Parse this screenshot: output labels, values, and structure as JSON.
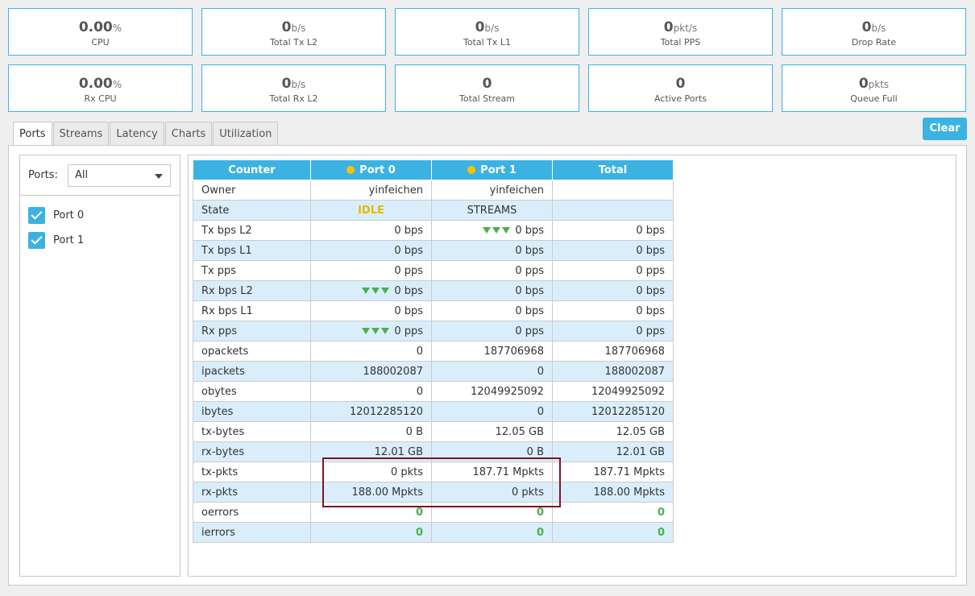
{
  "stats_row1": [
    {
      "value": "0.00",
      "unit": "%",
      "label": "CPU"
    },
    {
      "value": "0",
      "unit": "b/s",
      "label": "Total Tx L2"
    },
    {
      "value": "0",
      "unit": "b/s",
      "label": "Total Tx L1"
    },
    {
      "value": "0",
      "unit": "pkt/s",
      "label": "Total PPS"
    },
    {
      "value": "0",
      "unit": "b/s",
      "label": "Drop Rate"
    }
  ],
  "stats_row2": [
    {
      "value": "0.00",
      "unit": "%",
      "label": "Rx CPU"
    },
    {
      "value": "0",
      "unit": "b/s",
      "label": "Total Rx L2"
    },
    {
      "value": "0",
      "unit": "",
      "label": "Total Stream"
    },
    {
      "value": "0",
      "unit": "",
      "label": "Active Ports"
    },
    {
      "value": "0",
      "unit": "pkts",
      "label": "Queue Full"
    }
  ],
  "tabs": [
    "Ports",
    "Streams",
    "Latency",
    "Charts",
    "Utilization"
  ],
  "active_tab": "Ports",
  "clear_label": "Clear",
  "sidebar": {
    "filter_label": "Ports:",
    "filter_value": "All",
    "ports": [
      "Port 0",
      "Port 1"
    ]
  },
  "table": {
    "headers": [
      "Counter",
      "Port 0",
      "Port 1",
      "Total"
    ],
    "rows": [
      [
        "Owner",
        "yinfeichen",
        "yinfeichen",
        ""
      ],
      [
        "State",
        "IDLE",
        "STREAMS",
        ""
      ],
      [
        "Tx bps L2",
        "0 bps",
        "0 bps",
        "0 bps"
      ],
      [
        "Tx bps L1",
        "0 bps",
        "0 bps",
        "0 bps"
      ],
      [
        "Tx pps",
        "0 pps",
        "0 pps",
        "0 pps"
      ],
      [
        "Rx bps L2",
        "0 bps",
        "0 bps",
        "0 bps"
      ],
      [
        "Rx bps L1",
        "0 bps",
        "0 bps",
        "0 bps"
      ],
      [
        "Rx pps",
        "0 pps",
        "0 pps",
        "0 pps"
      ],
      [
        "opackets",
        "0",
        "187706968",
        "187706968"
      ],
      [
        "ipackets",
        "188002087",
        "0",
        "188002087"
      ],
      [
        "obytes",
        "0",
        "12049925092",
        "12049925092"
      ],
      [
        "ibytes",
        "12012285120",
        "0",
        "12012285120"
      ],
      [
        "tx-bytes",
        "0 B",
        "12.05 GB",
        "12.05 GB"
      ],
      [
        "rx-bytes",
        "12.01 GB",
        "0 B",
        "12.01 GB"
      ],
      [
        "tx-pkts",
        "0 pkts",
        "187.71 Mpkts",
        "187.71 Mpkts"
      ],
      [
        "rx-pkts",
        "188.00 Mpkts",
        "0 pkts",
        "188.00 Mpkts"
      ],
      [
        "oerrors",
        "0",
        "0",
        "0"
      ],
      [
        "ierrors",
        "0",
        "0",
        "0"
      ]
    ]
  },
  "colors": {
    "accent": "#3cb2e3",
    "row_alt": "#d9eefa",
    "idle": "#e8b800",
    "ok_green": "#4caf50",
    "highlight": "#7b1528"
  },
  "icons": {
    "port_status": "yellow-dot-icon",
    "rate_trend": "down-triangle-icon",
    "checkbox": "checkbox-checked-icon",
    "dropdown": "chevron-down-icon"
  }
}
